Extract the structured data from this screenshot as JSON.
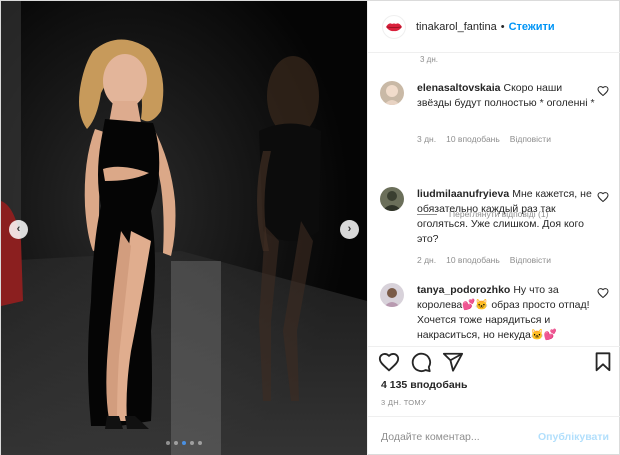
{
  "header": {
    "username": "tinakarol_fantina",
    "separator": "•",
    "follow_label": "Стежити",
    "logo_icon": "lips-icon"
  },
  "media": {
    "prev_icon": "chevron-left-icon",
    "next_icon": "chevron-right-icon",
    "prev_glyph": "‹",
    "next_glyph": "›",
    "slide_count": 5,
    "active_slide": 3
  },
  "comments": {
    "top_timestamp": "3 дн.",
    "items": [
      {
        "username": "elenasaltovskaia",
        "text": "Скоро наши звёзды будут полностью * оголенні *",
        "age": "3 дн.",
        "likes": "10 вподобань",
        "reply": "Відповісти"
      },
      {
        "username": "liudmilaanufryieva",
        "text": "Мне кажется, не обязательно каждый раз так оголяться. Уже слишком. Доя кого это?",
        "age": "2 дн.",
        "likes": "10 вподобань",
        "reply": "Відповісти"
      },
      {
        "username": "tanya_podorozhko",
        "text": "Ну что за королева💕🐱 образ просто отпад! Хочется тоже нарядиться и накраситься, но некуда🐱💕"
      }
    ],
    "view_replies": "Переглянути відповіді (1)"
  },
  "actions": {
    "likes": "4 135 вподобань",
    "time": "3 ДН. ТОМУ"
  },
  "add_comment": {
    "placeholder": "Додайте коментар...",
    "publish_label": "Опублікувати"
  },
  "colors": {
    "accent": "#0095f6",
    "publish_disabled": "#b2dffc",
    "muted": "#8e8e8e",
    "logo_red": "#d9203b"
  }
}
